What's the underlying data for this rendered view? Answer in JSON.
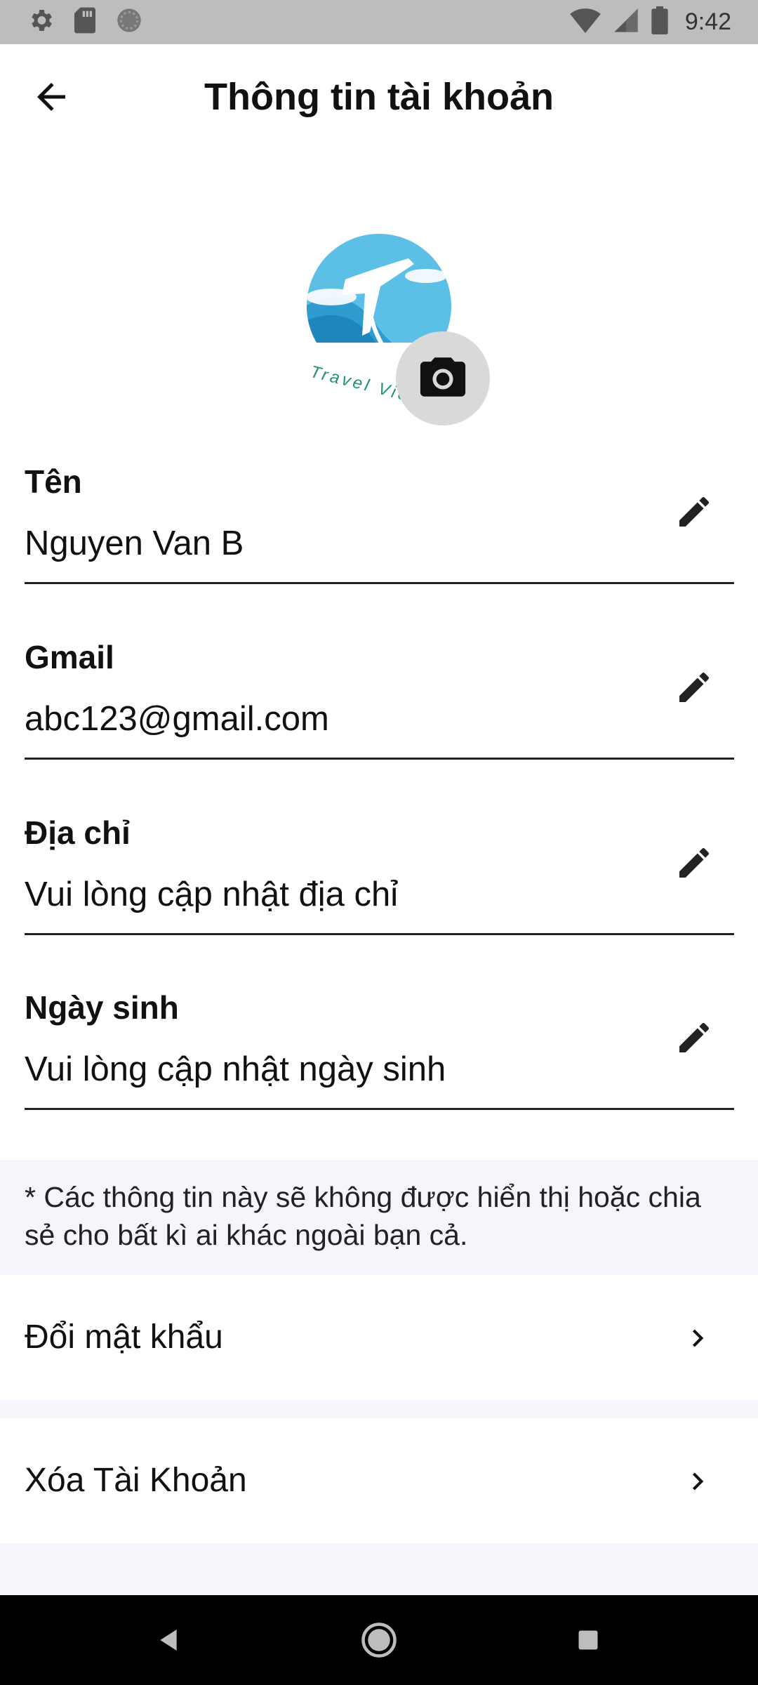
{
  "status_bar": {
    "time": "9:42",
    "icons": [
      "settings-icon",
      "sd-card-icon",
      "sync-icon",
      "wifi-icon",
      "signal-icon",
      "battery-icon"
    ]
  },
  "header": {
    "title": "Thông tin tài khoản",
    "back_icon": "arrow-left-icon"
  },
  "avatar": {
    "logo_text": "Travel Vietn",
    "camera_icon": "camera-icon"
  },
  "fields": [
    {
      "label": "Tên",
      "value": "Nguyen Van B"
    },
    {
      "label": "Gmail",
      "value": "abc123@gmail.com"
    },
    {
      "label": "Địa chỉ",
      "value": "Vui lòng cập nhật địa chỉ"
    },
    {
      "label": "Ngày sinh",
      "value": "Vui lòng cập nhật ngày sinh"
    }
  ],
  "note": "* Các thông tin này sẽ không được hiển thị hoặc chia sẻ cho bất kì ai khác ngoài bạn cả.",
  "menu": [
    {
      "label": "Đổi mật khẩu"
    },
    {
      "label": "Xóa Tài Khoản"
    }
  ],
  "colors": {
    "status_bar_bg": "#bdbdbd",
    "note_bg": "#f4f6fb",
    "logo_blue": "#4fb8df",
    "camera_bg": "#d9d9d9"
  }
}
